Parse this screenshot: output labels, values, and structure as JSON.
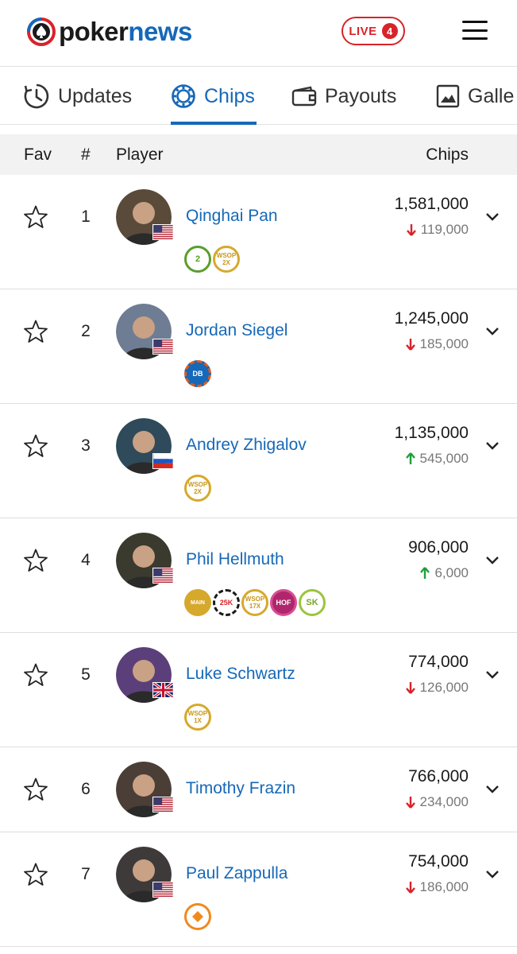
{
  "header": {
    "logo_part1": "poker",
    "logo_part2": "news",
    "live_label": "LIVE",
    "live_count": "4"
  },
  "tabs": [
    {
      "label": "Updates",
      "icon": "clock-icon"
    },
    {
      "label": "Chips",
      "icon": "chip-icon",
      "active": true
    },
    {
      "label": "Payouts",
      "icon": "wallet-icon"
    },
    {
      "label": "Galle",
      "icon": "image-icon"
    }
  ],
  "table": {
    "headers": {
      "fav": "Fav",
      "rank": "#",
      "player": "Player",
      "chips": "Chips"
    },
    "rows": [
      {
        "rank": "1",
        "name": "Qinghai Pan",
        "country": "USA",
        "chips": "1,581,000",
        "direction": "down",
        "delta": "119,000",
        "badges": [
          {
            "text": "2",
            "kind": "green-ring"
          },
          {
            "text": "WSOP 2X",
            "kind": "gold-ring"
          }
        ]
      },
      {
        "rank": "2",
        "name": "Jordan Siegel",
        "country": "USA",
        "chips": "1,245,000",
        "direction": "down",
        "delta": "185,000",
        "badges": [
          {
            "text": "DB",
            "kind": "db-chip"
          }
        ]
      },
      {
        "rank": "3",
        "name": "Andrey Zhigalov",
        "country": "Russia",
        "chips": "1,135,000",
        "direction": "up",
        "delta": "545,000",
        "badges": [
          {
            "text": "WSOP 2X",
            "kind": "gold-ring"
          }
        ]
      },
      {
        "rank": "4",
        "name": "Phil Hellmuth",
        "country": "USA",
        "chips": "906,000",
        "direction": "up",
        "delta": "6,000",
        "badges": [
          {
            "text": "MAIN",
            "kind": "gold-trophy"
          },
          {
            "text": "25K",
            "kind": "black-chip"
          },
          {
            "text": "WSOP 17X",
            "kind": "gold-ring"
          },
          {
            "text": "HOF",
            "kind": "magenta"
          },
          {
            "text": "SK",
            "kind": "green-sk"
          }
        ]
      },
      {
        "rank": "5",
        "name": "Luke Schwartz",
        "country": "UK",
        "chips": "774,000",
        "direction": "down",
        "delta": "126,000",
        "badges": [
          {
            "text": "WSOP 1X",
            "kind": "gold-ring"
          }
        ]
      },
      {
        "rank": "6",
        "name": "Timothy Frazin",
        "country": "USA",
        "chips": "766,000",
        "direction": "down",
        "delta": "234,000",
        "badges": []
      },
      {
        "rank": "7",
        "name": "Paul Zappulla",
        "country": "USA",
        "chips": "754,000",
        "direction": "down",
        "delta": "186,000",
        "badges": [
          {
            "text": "",
            "kind": "orange-diamond"
          }
        ]
      }
    ]
  },
  "colors": {
    "brand_blue": "#1668b8",
    "live_red": "#d8232a",
    "up_green": "#1f9e3a",
    "down_red": "#d8232a"
  }
}
